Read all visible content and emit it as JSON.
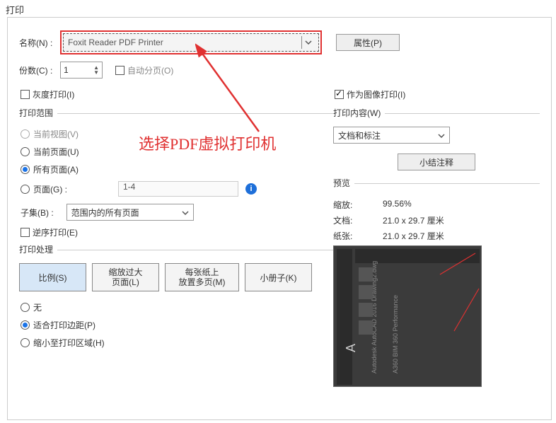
{
  "dialog": {
    "title": "打印"
  },
  "printer": {
    "name_label": "名称(N) :",
    "selected": "Foxit Reader PDF Printer",
    "properties_btn": "属性(P)"
  },
  "copies": {
    "label": "份数(C) :",
    "value": "1",
    "collate_label": "自动分页(O)"
  },
  "grayscale_label": "灰度打印(I)",
  "print_as_image_label": "作为图像打印(I)",
  "range": {
    "section": "打印范围",
    "current_view": "当前视图(V)",
    "current_page": "当前页面(U)",
    "all_pages": "所有页面(A)",
    "pages": "页面(G) :",
    "pages_placeholder": "1-4",
    "subset_label": "子集(B) :",
    "subset_value": "范围内的所有页面",
    "reverse": "逆序打印(E)"
  },
  "annotation_note": "选择PDF虚拟打印机",
  "handling": {
    "section": "打印处理",
    "scale": "比例(S)",
    "zoom_big": "缩放过大\n页面(L)",
    "multi": "每张纸上\n放置多页(M)",
    "booklet": "小册子(K)",
    "none": "无",
    "fit": "适合打印边距(P)",
    "shrink": "缩小至打印区域(H)"
  },
  "content": {
    "section": "打印内容(W)",
    "value": "文档和标注",
    "summary_btn": "小结注释"
  },
  "preview": {
    "section": "预览",
    "zoom_label": "缩放:",
    "zoom_value": "99.56%",
    "doc_label": "文档:",
    "doc_value": "21.0 x 29.7 厘米",
    "paper_label": "纸张:",
    "paper_value": "21.0 x 29.7 厘米"
  }
}
